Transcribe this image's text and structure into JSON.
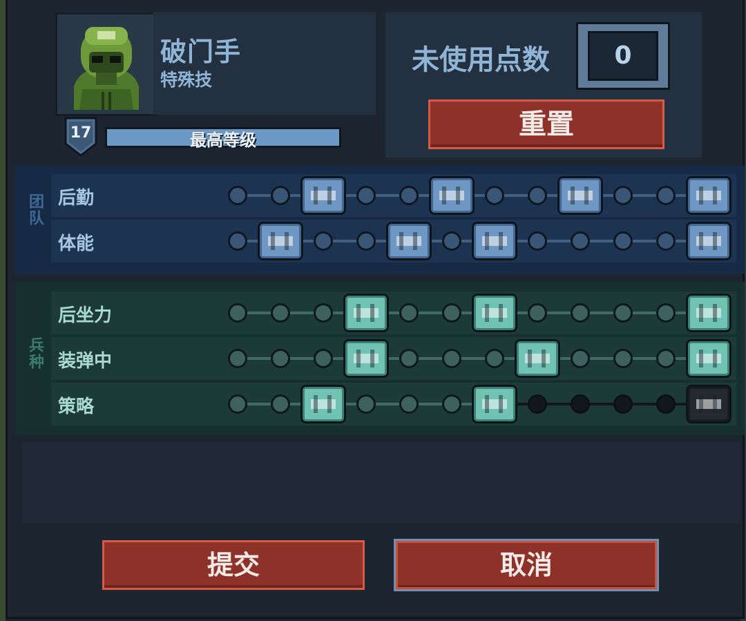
{
  "header": {
    "class_name": "破门手",
    "class_type": "特殊技",
    "level": "17",
    "xp_label": "最高等级",
    "xp_progress": 1.0
  },
  "points": {
    "label": "未使用点数",
    "value": "0",
    "reset_label": "重置"
  },
  "sections": [
    {
      "label": "团队",
      "rows": [
        {
          "label": "后勤",
          "slots": [
            "n",
            "n",
            "S:supply-crate-icon",
            "n",
            "n",
            "S:shield-plus-icon",
            "n",
            "n",
            "S:medkit-icon",
            "n",
            "n",
            "S:ammo-box-icon"
          ]
        },
        {
          "label": "体能",
          "slots": [
            "n",
            "S:knife-icon",
            "n",
            "n",
            "S:sprint-icon",
            "n",
            "S:armor-plates-icon",
            "n",
            "n",
            "n",
            "n",
            "S:soldier-head-icon"
          ]
        }
      ]
    },
    {
      "label": "兵种",
      "rows": [
        {
          "label": "后坐力",
          "slots": [
            "n",
            "n",
            "n",
            "S:grip-icon",
            "n",
            "n",
            "S:burst-icon",
            "n",
            "n",
            "n",
            "n",
            "S:spray-icon"
          ]
        },
        {
          "label": "装弹中",
          "slots": [
            "n",
            "n",
            "n",
            "S:reload-plus-icon",
            "n",
            "n",
            "n",
            "S:magazine-icon",
            "n",
            "n",
            "n",
            "S:shotgun-icon"
          ]
        },
        {
          "label": "策略",
          "slots": [
            "n",
            "n",
            "S:breach-icon",
            "n",
            "n",
            "n",
            "S:fist-icon",
            "x",
            "x",
            "x",
            "x",
            "L:locked-skill-icon"
          ]
        }
      ]
    }
  ],
  "actions": {
    "submit_label": "提交",
    "cancel_label": "取消"
  },
  "colors": {
    "team_accent": "#6f97c4",
    "class_accent": "#6fc2b4",
    "button_red": "#8e3229"
  }
}
